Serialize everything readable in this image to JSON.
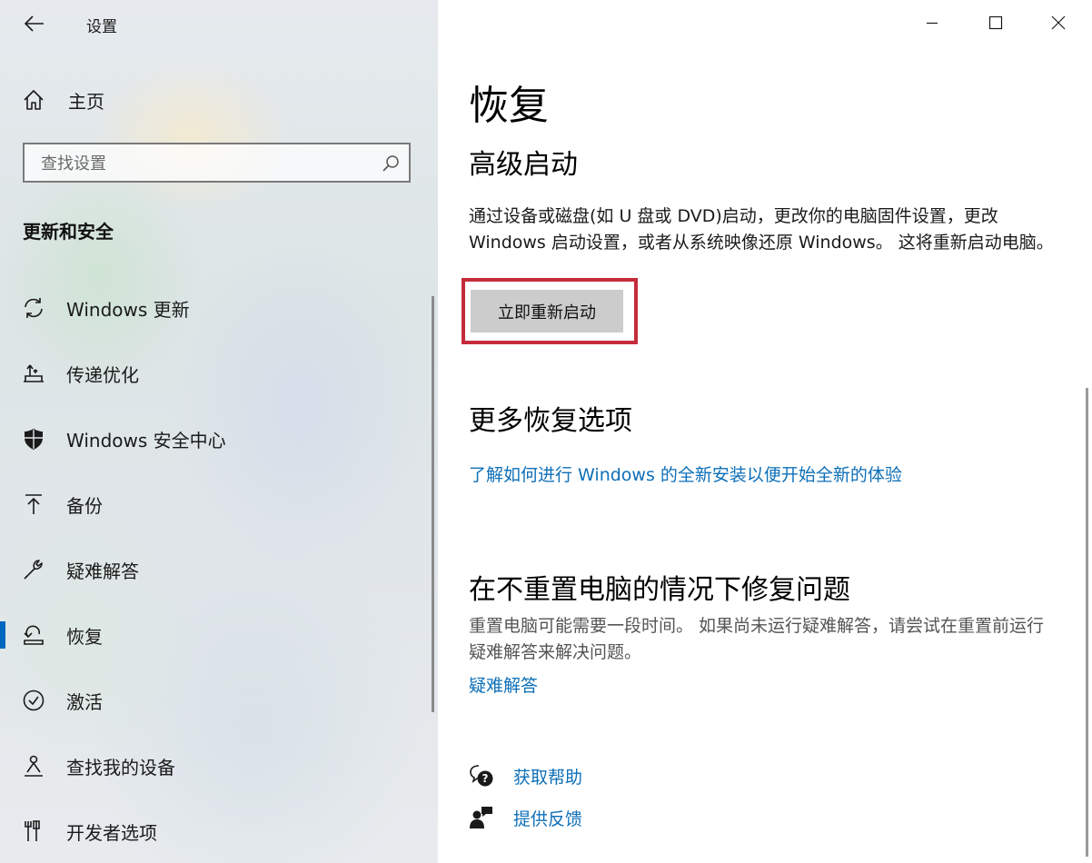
{
  "window": {
    "title": "设置",
    "controls": [
      "minimize",
      "maximize",
      "close"
    ]
  },
  "sidebar": {
    "home_label": "主页",
    "search_placeholder": "查找设置",
    "section_title": "更新和安全",
    "items": [
      {
        "label": "Windows 更新",
        "icon": "sync-icon",
        "selected": false
      },
      {
        "label": "传递优化",
        "icon": "delivery-optimization-icon",
        "selected": false
      },
      {
        "label": "Windows 安全中心",
        "icon": "shield-icon",
        "selected": false
      },
      {
        "label": "备份",
        "icon": "backup-arrow-icon",
        "selected": false
      },
      {
        "label": "疑难解答",
        "icon": "wrench-icon",
        "selected": false
      },
      {
        "label": "恢复",
        "icon": "recovery-icon",
        "selected": true
      },
      {
        "label": "激活",
        "icon": "check-circle-icon",
        "selected": false
      },
      {
        "label": "查找我的设备",
        "icon": "person-location-icon",
        "selected": false
      },
      {
        "label": "开发者选项",
        "icon": "developer-tools-icon",
        "selected": false
      }
    ]
  },
  "main": {
    "page_title": "恢复",
    "advanced_startup": {
      "heading": "高级启动",
      "description": "通过设备或磁盘(如 U 盘或 DVD)启动，更改你的电脑固件设置，更改 Windows 启动设置，或者从系统映像还原 Windows。 这将重新启动电脑。",
      "button_label": "立即重新启动"
    },
    "more_options": {
      "heading": "更多恢复选项",
      "link": "了解如何进行 Windows 的全新安装以便开始全新的体验"
    },
    "fix_without_reset": {
      "heading": "在不重置电脑的情况下修复问题",
      "description": "重置电脑可能需要一段时间。 如果尚未运行疑难解答，请尝试在重置前运行疑难解答来解决问题。",
      "link": "疑难解答"
    },
    "help": {
      "get_help": "获取帮助",
      "feedback": "提供反馈"
    }
  },
  "colors": {
    "accent": "#0067c0",
    "link": "#0d6fb8",
    "highlight_border": "#c42b3b",
    "button_bg": "#cccccc"
  }
}
